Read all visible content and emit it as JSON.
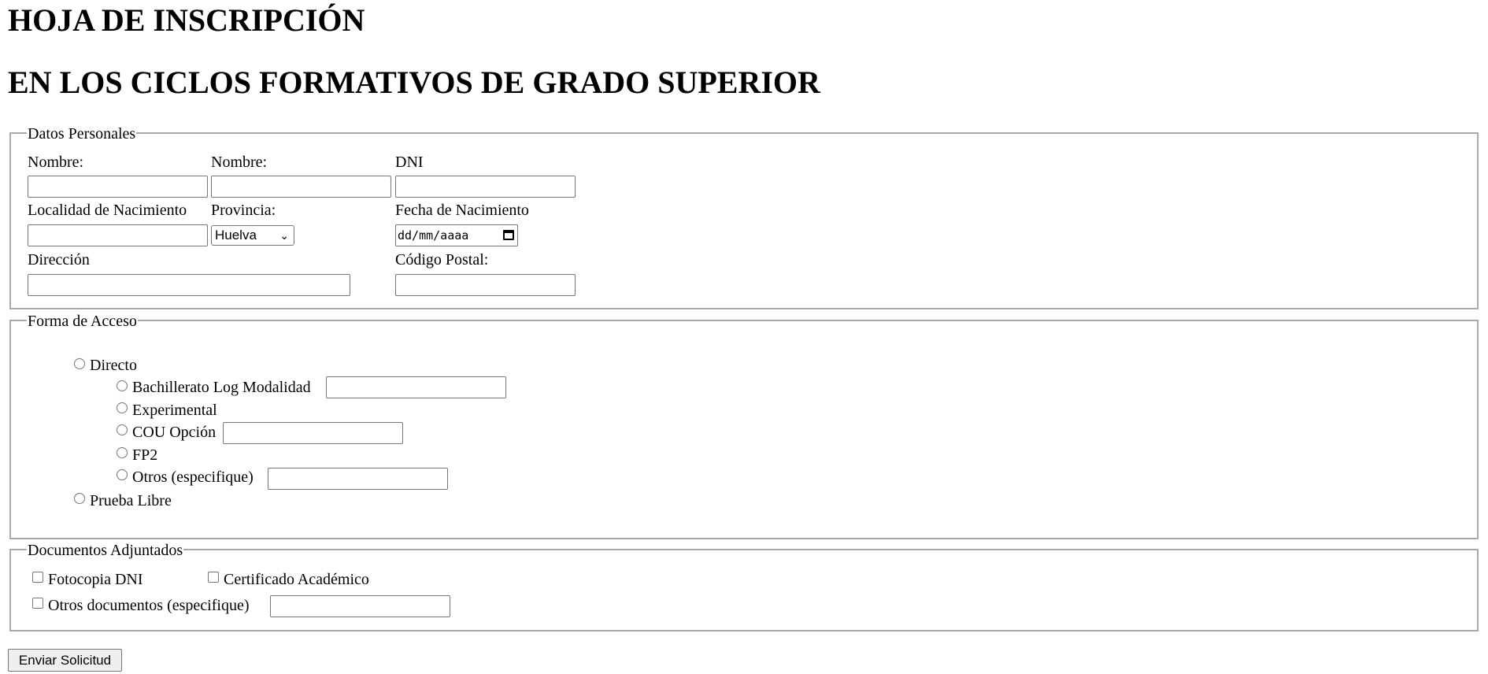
{
  "title_line1": "HOJA DE INSCRIPCIÓN",
  "title_line2": "EN LOS CICLOS FORMATIVOS DE GRADO SUPERIOR",
  "personal": {
    "legend": "Datos Personales",
    "nombre_label": "Nombre:",
    "nombre2_label": "Nombre:",
    "dni_label": "DNI",
    "localidad_label": "Localidad de Nacimiento",
    "provincia_label": "Provincia:",
    "provincia_value": "Huelva",
    "fecha_label": "Fecha de Nacimiento",
    "fecha_placeholder": "dd/mm/aaaa",
    "direccion_label": "Dirección",
    "cp_label": "Código Postal:"
  },
  "access": {
    "legend": "Forma de Acceso",
    "directo": "Directo",
    "bachillerato": "Bachillerato Log Modalidad",
    "experimental": "Experimental",
    "cou": "COU Opción",
    "fp2": "FP2",
    "otros": "Otros (especifique)",
    "prueba_libre": "Prueba Libre"
  },
  "docs": {
    "legend": "Documentos Adjuntados",
    "fotocopia": "Fotocopia DNI",
    "certificado": "Certificado Académico",
    "otros": "Otros documentos (especifique)"
  },
  "submit_label": "Enviar Solicitud",
  "icons": {
    "dropdown": "chevron-down-icon",
    "calendar": "calendar-icon"
  }
}
